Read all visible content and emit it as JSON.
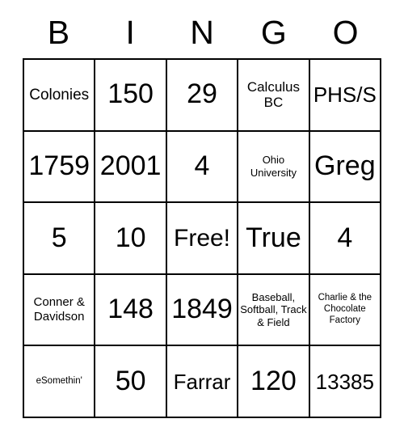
{
  "card": {
    "header_letters": [
      "B",
      "I",
      "N",
      "G",
      "O"
    ],
    "free_space_label": "Free!",
    "colors": {
      "background": "#ffffff",
      "grid_line": "#000000",
      "text": "#000000"
    },
    "rows": [
      [
        {
          "text": "Colonies",
          "size": "fs-m"
        },
        {
          "text": "150",
          "size": "fs-xxl"
        },
        {
          "text": "29",
          "size": "fs-xxl"
        },
        {
          "text": "Calculus BC",
          "size": "fs-s"
        },
        {
          "text": "PHS/S",
          "size": "fs-l"
        }
      ],
      [
        {
          "text": "1759",
          "size": "fs-xxl"
        },
        {
          "text": "2001",
          "size": "fs-xxl"
        },
        {
          "text": "4",
          "size": "fs-xxl"
        },
        {
          "text": "Ohio University",
          "size": "fs-xxs"
        },
        {
          "text": "Greg",
          "size": "fs-xxl"
        }
      ],
      [
        {
          "text": "5",
          "size": "fs-xxl"
        },
        {
          "text": "10",
          "size": "fs-xxl"
        },
        {
          "text": "Free!",
          "size": "fs-xl"
        },
        {
          "text": "True",
          "size": "fs-xxl"
        },
        {
          "text": "4",
          "size": "fs-xxl"
        }
      ],
      [
        {
          "text": "Conner & Davidson",
          "size": "fs-xs"
        },
        {
          "text": "148",
          "size": "fs-xxl"
        },
        {
          "text": "1849",
          "size": "fs-xxl"
        },
        {
          "text": "Baseball, Softball, Track & Field",
          "size": "fs-xxs"
        },
        {
          "text": "Charlie & the Chocolate Factory",
          "size": "fs-tiny"
        }
      ],
      [
        {
          "text": "eSomethin'",
          "size": "fs-tiny"
        },
        {
          "text": "50",
          "size": "fs-xxl"
        },
        {
          "text": "Farrar",
          "size": "fs-l"
        },
        {
          "text": "120",
          "size": "fs-xxl"
        },
        {
          "text": "13385",
          "size": "fs-l"
        }
      ]
    ]
  }
}
